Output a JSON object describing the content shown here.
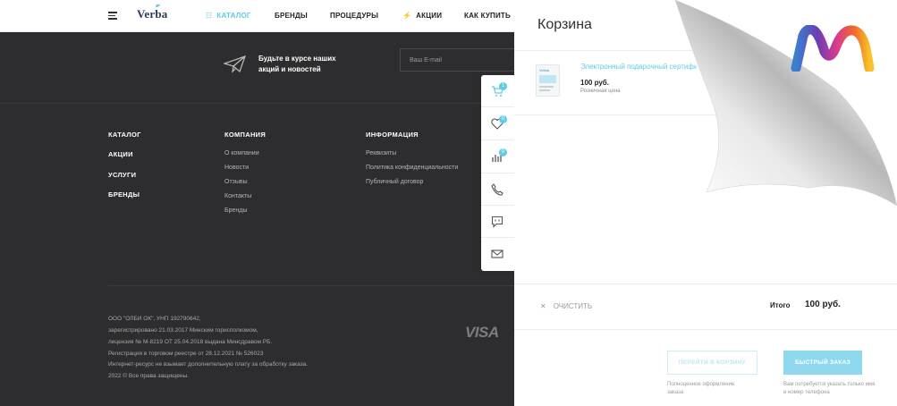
{
  "header": {
    "logo": "Verba",
    "nav": [
      "КАТАЛОГ",
      "БРЕНДЫ",
      "ПРОЦЕДУРЫ",
      "АКЦИИ",
      "КАК КУПИТЬ"
    ]
  },
  "subscribe": {
    "text": "Будьте в курсе наших акций и новостей",
    "placeholder": "Ваш E-mail"
  },
  "footer": {
    "col1": [
      "КАТАЛОГ",
      "АКЦИИ",
      "УСЛУГИ",
      "БРЕНДЫ"
    ],
    "col2_title": "КОМПАНИЯ",
    "col2": [
      "О компании",
      "Новости",
      "Отзывы",
      "Контакты",
      "Бренды"
    ],
    "col3_title": "ИНФОРМАЦИЯ",
    "col3": [
      "Реквизиты",
      "Политика конфиденциальности",
      "Публичный договор"
    ],
    "legal": [
      "ООО \"ОЛБИ ОК\", УНП 192790642,",
      "зарегистрировано 21.03.2017 Минским горисполкомом,",
      "лицензия № М-8219 ОТ 25.04.2018 выдана Минсдравом РБ.",
      "Регистрация в торговом реестре от 28.12.2021 № 526023",
      "Интернет-ресурс не взымает дополнительную плату за обработку заказа.",
      "2022 © Все права защищены."
    ],
    "payment": "VISA"
  },
  "side_panel": {
    "cart_count": "1",
    "wishlist_count": "0",
    "compare_count": "0"
  },
  "cart": {
    "title": "Корзина",
    "item": {
      "thumb_label": "Verba",
      "name": "Электронный подарочный сертификат",
      "price": "100 руб.",
      "note": "Розничная цена"
    },
    "clear_label": "ОЧИСТИТЬ",
    "total_label": "Итого",
    "total_value": "100 руб.",
    "go_to_cart": "ПЕРЕЙТИ В КОРЗИНУ",
    "go_to_cart_note": "Полноценное оформление заказа",
    "quick_order": "БЫСТРЫЙ ЗАКАЗ",
    "quick_order_note": "Вам потребуется указать только имя и номер телефона"
  },
  "colors": {
    "accent": "#5ecbe7",
    "footer_bg": "#2d2d2f"
  }
}
